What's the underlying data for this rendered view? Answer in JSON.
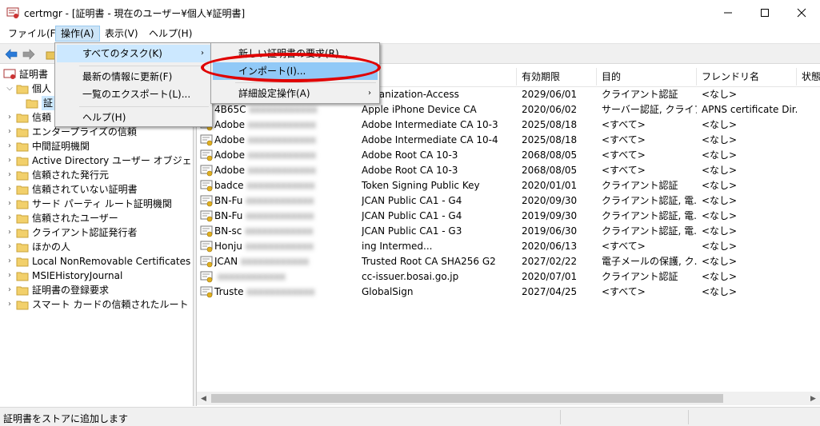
{
  "window": {
    "title": "certmgr - [証明書 - 現在のユーザー¥個人¥証明書]"
  },
  "menubar": {
    "items": [
      {
        "label": "ファイル(F)"
      },
      {
        "label": "操作(A)"
      },
      {
        "label": "表示(V)"
      },
      {
        "label": "ヘルプ(H)"
      }
    ]
  },
  "tree": {
    "root": "証明書",
    "personal": "個人",
    "personal_child": "証",
    "items": [
      "信頼",
      "エンタープライズの信頼",
      "中間証明機関",
      "Active Directory ユーザー オブジェクト",
      "信頼された発行元",
      "信頼されていない証明書",
      "サード パーティ ルート証明機関",
      "信頼されたユーザー",
      "クライアント認証発行者",
      "ほかの人",
      "Local NonRemovable Certificates",
      "MSIEHistoryJournal",
      "証明書の登録要求",
      "スマート カードの信頼されたルート"
    ]
  },
  "table": {
    "columns": [
      "者",
      "有効期限",
      "目的",
      "フレンドリ名",
      "状態"
    ],
    "rows": [
      {
        "name": "",
        "issuer": "Organization-Access",
        "expiry": "2029/06/01",
        "purpose": "クライアント認証",
        "friendly": "<なし>"
      },
      {
        "name": "4B65C",
        "issuer": "Apple iPhone Device CA",
        "expiry": "2020/06/02",
        "purpose": "サーバー認証, クライア...",
        "friendly": "APNS certificate Dir..."
      },
      {
        "name": "Adobe",
        "issuer": "Adobe Intermediate CA 10-3",
        "expiry": "2025/08/18",
        "purpose": "<すべて>",
        "friendly": "<なし>"
      },
      {
        "name": "Adobe",
        "issuer": "Adobe Intermediate CA 10-4",
        "expiry": "2025/08/18",
        "purpose": "<すべて>",
        "friendly": "<なし>"
      },
      {
        "name": "Adobe",
        "issuer": "Adobe Root CA 10-3",
        "expiry": "2068/08/05",
        "purpose": "<すべて>",
        "friendly": "<なし>"
      },
      {
        "name": "Adobe",
        "issuer": "Adobe Root CA 10-3",
        "expiry": "2068/08/05",
        "purpose": "<すべて>",
        "friendly": "<なし>"
      },
      {
        "name": "badce",
        "issuer": "Token Signing Public Key",
        "expiry": "2020/01/01",
        "purpose": "クライアント認証",
        "friendly": "<なし>"
      },
      {
        "name": "BN-Fu",
        "issuer": "JCAN Public CA1 - G4",
        "expiry": "2020/09/30",
        "purpose": "クライアント認証, 電...",
        "friendly": "<なし>"
      },
      {
        "name": "BN-Fu",
        "issuer": "JCAN Public CA1 - G4",
        "expiry": "2019/09/30",
        "purpose": "クライアント認証, 電...",
        "friendly": "<なし>"
      },
      {
        "name": "BN-sc",
        "issuer": "JCAN Public CA1 - G3",
        "expiry": "2019/06/30",
        "purpose": "クライアント認証, 電...",
        "friendly": "<なし>"
      },
      {
        "name": "Honju",
        "issuer": "ing Intermed...",
        "expiry": "2020/06/13",
        "purpose": "<すべて>",
        "friendly": "<なし>"
      },
      {
        "name": "JCAN",
        "issuer": "Trusted Root CA SHA256 G2",
        "expiry": "2027/02/22",
        "purpose": "電子メールの保護, ク...",
        "friendly": "<なし>"
      },
      {
        "name": "",
        "issuer": "cc-issuer.bosai.go.jp",
        "expiry": "2020/07/01",
        "purpose": "クライアント認証",
        "friendly": "<なし>"
      },
      {
        "name": "Truste",
        "issuer": "GlobalSign",
        "expiry": "2027/04/25",
        "purpose": "<すべて>",
        "friendly": "<なし>"
      }
    ]
  },
  "action_menu": {
    "items": [
      {
        "label": "すべてのタスク(K)"
      },
      {
        "label": "最新の情報に更新(F)"
      },
      {
        "label": "一覧のエクスポート(L)..."
      },
      {
        "label": "ヘルプ(H)"
      }
    ]
  },
  "task_submenu": {
    "items": [
      {
        "label": "新しい証明書の要求(R)..."
      },
      {
        "label": "インポート(I)..."
      },
      {
        "label": "詳細設定操作(A)"
      }
    ]
  },
  "status": {
    "text": "証明書をストアに追加します"
  },
  "colors": {
    "highlight": "#91c9f7",
    "annotation_oval": "#e00000"
  }
}
